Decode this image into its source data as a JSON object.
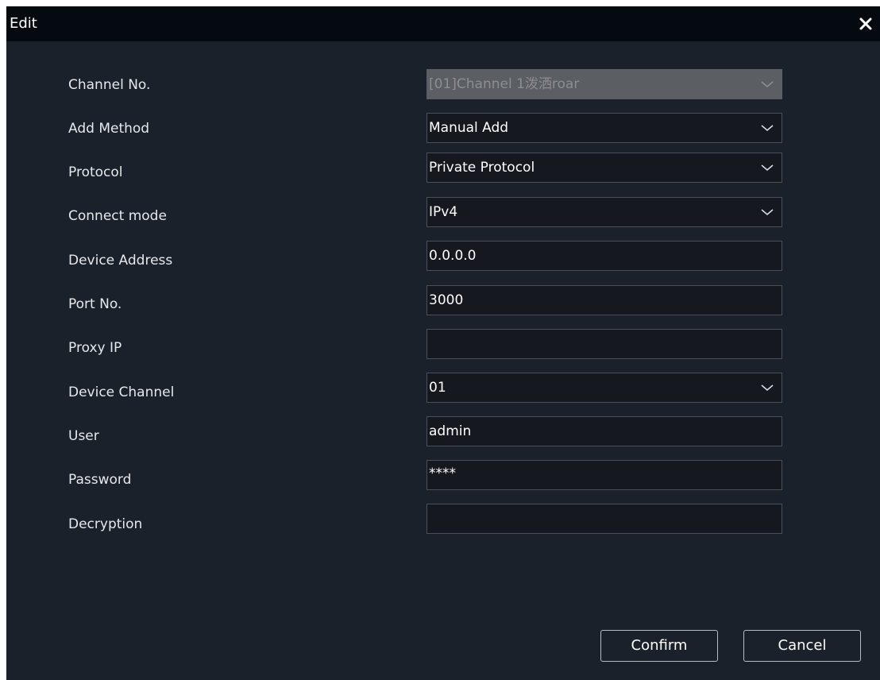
{
  "dialog": {
    "title": "Edit",
    "close_icon": "close-icon"
  },
  "fields": {
    "channel_no": {
      "label": "Channel No.",
      "value": "[01]Channel 1泼洒roar",
      "type": "select",
      "disabled": true
    },
    "add_method": {
      "label": "Add Method",
      "value": "Manual Add",
      "type": "select"
    },
    "protocol": {
      "label": "Protocol",
      "value": "Private Protocol",
      "type": "select"
    },
    "connect_mode": {
      "label": "Connect mode",
      "value": "IPv4",
      "type": "select"
    },
    "device_address": {
      "label": "Device Address",
      "value": "0.0.0.0",
      "type": "input"
    },
    "port_no": {
      "label": "Port No.",
      "value": "3000",
      "type": "input"
    },
    "proxy_ip": {
      "label": "Proxy IP",
      "value": "",
      "type": "input"
    },
    "device_channel": {
      "label": "Device Channel",
      "value": "01",
      "type": "select"
    },
    "user": {
      "label": "User",
      "value": "admin",
      "type": "input"
    },
    "password": {
      "label": "Password",
      "value": "****",
      "type": "password"
    },
    "decryption": {
      "label": "Decryption",
      "value": "",
      "type": "input"
    }
  },
  "buttons": {
    "confirm": "Confirm",
    "cancel": "Cancel"
  },
  "colors": {
    "panel_background": "#1b212b",
    "title_bar": "#050a10",
    "field_background": "#15191f",
    "field_border": "#4a5059",
    "disabled_field": "#5b5e63",
    "text": "#ffffff"
  }
}
